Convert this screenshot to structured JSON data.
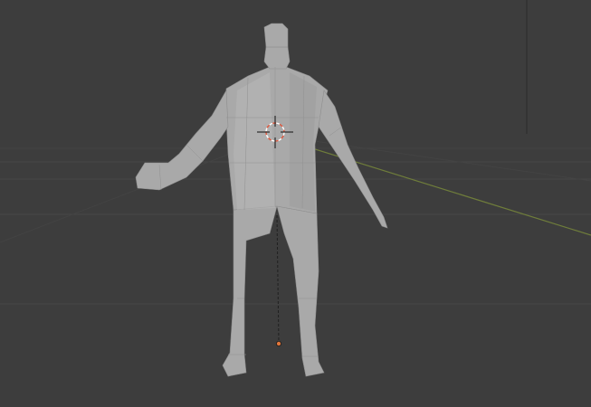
{
  "app": "3D viewport",
  "viewport": {
    "background_color": "#3d3d3d",
    "grid_color": "#474747",
    "x_axis_color": "#6f7d3b",
    "mesh_color": "#a9a9a9",
    "cursor_colors": [
      "#ffffff",
      "#e0563b"
    ],
    "origin_color": "#e0763b"
  },
  "objects": {
    "mesh": "humanoid-mesh",
    "cursor": "3d-cursor-icon",
    "origin": "object-origin-point"
  }
}
